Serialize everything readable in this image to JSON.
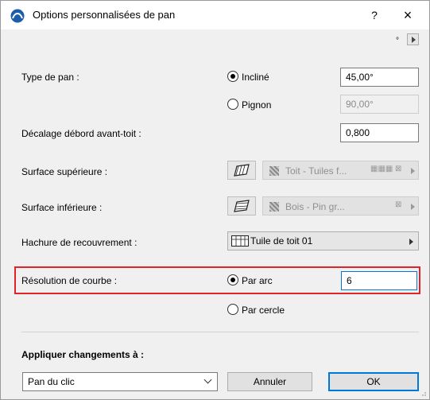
{
  "window": {
    "title": "Options personnalisées de pan",
    "help_label": "?",
    "close_label": "×"
  },
  "top_indicator": "°",
  "roof_type": {
    "label": "Type de pan :",
    "options": [
      {
        "label": "Incliné",
        "checked": true,
        "value": "45,00°",
        "enabled": true
      },
      {
        "label": "Pignon",
        "checked": false,
        "value": "90,00°",
        "enabled": false
      }
    ]
  },
  "eave_offset": {
    "label": "Décalage débord avant-toit :",
    "value": "0,800"
  },
  "top_surface": {
    "label": "Surface supérieure :",
    "material": "Toit - Tuiles f..."
  },
  "bottom_surface": {
    "label": "Surface inférieure :",
    "material": "Bois - Pin gr..."
  },
  "cover_fill": {
    "label": "Hachure de recouvrement :",
    "value": "Tuile de toit 01"
  },
  "curve_resolution": {
    "label": "Résolution de courbe :",
    "options": [
      {
        "label": "Par arc",
        "checked": true
      },
      {
        "label": "Par cercle",
        "checked": false
      }
    ],
    "value": "6"
  },
  "apply": {
    "label": "Appliquer changements à :",
    "selected": "Pan du clic"
  },
  "buttons": {
    "cancel": "Annuler",
    "ok": "OK"
  },
  "colors": {
    "highlight": "#e2232a",
    "accent": "#0078d7"
  }
}
